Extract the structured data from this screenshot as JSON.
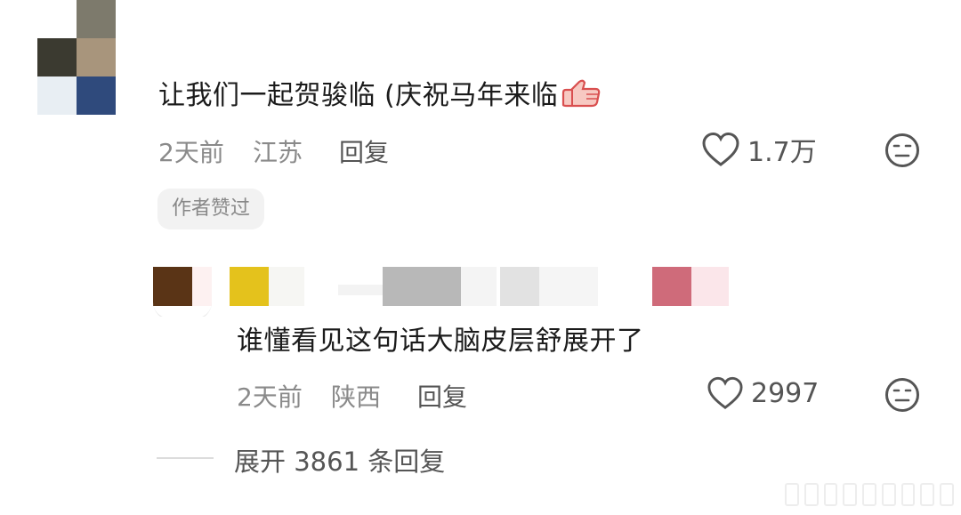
{
  "comment": {
    "text": "让我们一起贺骏临 (庆祝马年来临",
    "emoji": "thumbs-up-emoji",
    "time": "2天前",
    "location": "江苏",
    "reply_label": "回复",
    "like_count": "1.7万",
    "author_badge": "作者赞过"
  },
  "reply": {
    "text": "谁懂看见这句话大脑皮层舒展开了",
    "time": "2天前",
    "location": "陕西",
    "reply_label": "回复",
    "like_count": "2997"
  },
  "expand": {
    "label": "展开 3861 条回复"
  },
  "colors": {
    "text_primary": "#1b1b1b",
    "text_meta": "#8a8a8a",
    "text_action": "#555555",
    "badge_bg": "#f2f2f2"
  }
}
